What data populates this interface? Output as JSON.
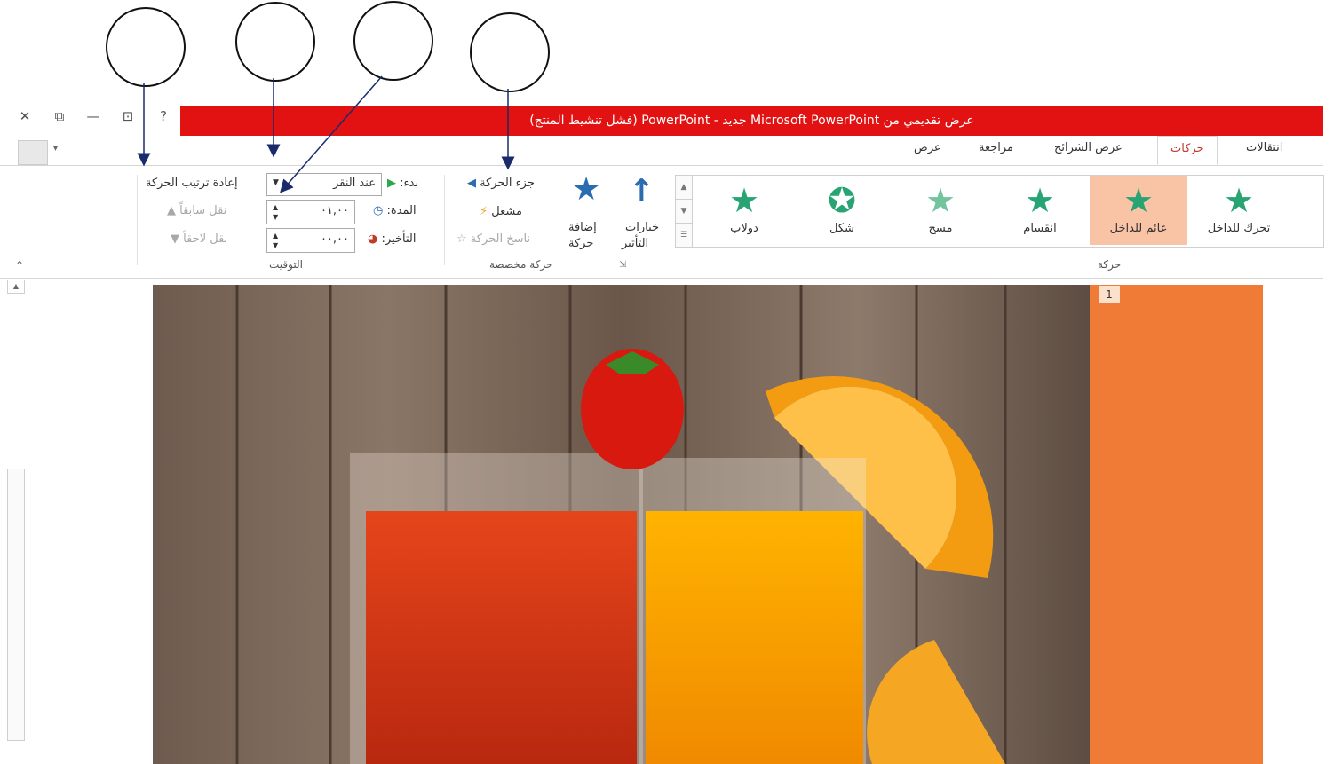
{
  "window": {
    "title": "عرض تقديمي من Microsoft PowerPoint جديد - PowerPoint (فشل تنشيط المنتج)",
    "help_icon": "?",
    "minimize_icon": "—",
    "close_icon": "✕"
  },
  "tabs": [
    "انتقالات",
    "حركات",
    "عرض الشرائح",
    "مراجعة",
    "عرض"
  ],
  "active_tab": "حركات",
  "animation_gallery": {
    "items": [
      "تحرك للداخل",
      "عائم للداخل",
      "انقسام",
      "مسح",
      "شكل",
      "دولاب"
    ],
    "selected": "عائم للداخل",
    "group_label": "حركة"
  },
  "effect_options": {
    "label_line1": "خيارات",
    "label_line2": "التأثير"
  },
  "advanced_animation": {
    "add_animation_line1": "إضافة",
    "add_animation_line2": "حركة",
    "animation_pane": "جزء الحركة",
    "trigger": "مشغل",
    "animation_painter": "ناسخ الحركة",
    "group_label": "حركة مخصصة"
  },
  "timing": {
    "start_label": "بدء:",
    "start_value": "عند النقر",
    "duration_label": "المدة:",
    "duration_value": "٠١,٠٠",
    "delay_label": "التأخير:",
    "delay_value": "٠٠,٠٠",
    "reorder_title": "إعادة ترتيب الحركة",
    "move_earlier": "نقل سابقاً",
    "move_later": "نقل لاحقاً",
    "group_label": "التوقيت"
  },
  "slide_panel": {
    "slide_number": "1"
  },
  "colors": {
    "title_bar": "#e21212",
    "accent": "#c0392b",
    "star_green": "#28a474",
    "selected_item": "#f9c3a6",
    "slide_orange": "#ef7b36"
  }
}
